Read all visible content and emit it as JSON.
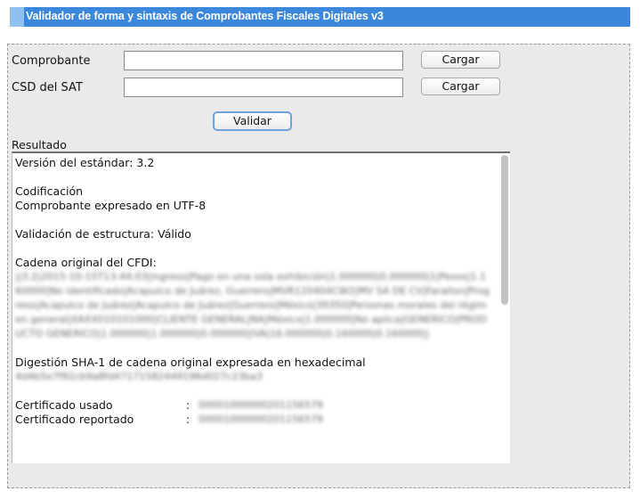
{
  "page": {
    "title": "Validador de forma y sintaxis de Comprobantes Fiscales Digitales v3"
  },
  "form": {
    "comprobante_label": "Comprobante",
    "comprobante_value": "",
    "comprobante_button": "Cargar",
    "csd_label": "CSD del SAT",
    "csd_value": "",
    "csd_button": "Cargar",
    "validate_button": "Validar"
  },
  "result": {
    "label": "Resultado",
    "version": "Versión del estándar: 3.2",
    "encoding_title": "Codificación",
    "encoding_value": "Comprobante expresado en UTF-8",
    "structure": "Validación de estructura: Válido",
    "original_chain_title": "Cadena original del CFDI:",
    "original_chain_value": "||3.2|2015-10-15T13:44:03|ingreso|Pago en una sola exhibición|1.000000|0.000000|1|Pesos|1.160000|No identificado|Acapulco de Juárez, Guerrero|MVR120404CW2|MV SA DE CV|Farallon|Progreso|Acapulco de Juárez|Acapulco de Juárez|Guerrero|México|39350|Personas morales del régimen general|XAXX010101000|CLIENTE GENERAL|NA|México|1.000000|No aplica|GENERICO|PRODUCTO GENERICO|1.000000|1.000000|0.000000|IVA|16.000000|0.160000|0.160000||",
    "sha1_title": "Digestión SHA-1 de cadena original expresada en hexadecimal",
    "sha1_value": "4d4b5e7f92cb9a8fd47171582449196d027c23ba3",
    "cert_used_label": "Certificado usado",
    "cert_used_sep": ":",
    "cert_used_value": "00001000000201156579",
    "cert_reported_label": "Certificado reportado",
    "cert_reported_sep": ":",
    "cert_reported_value": "00001000000201156579"
  }
}
